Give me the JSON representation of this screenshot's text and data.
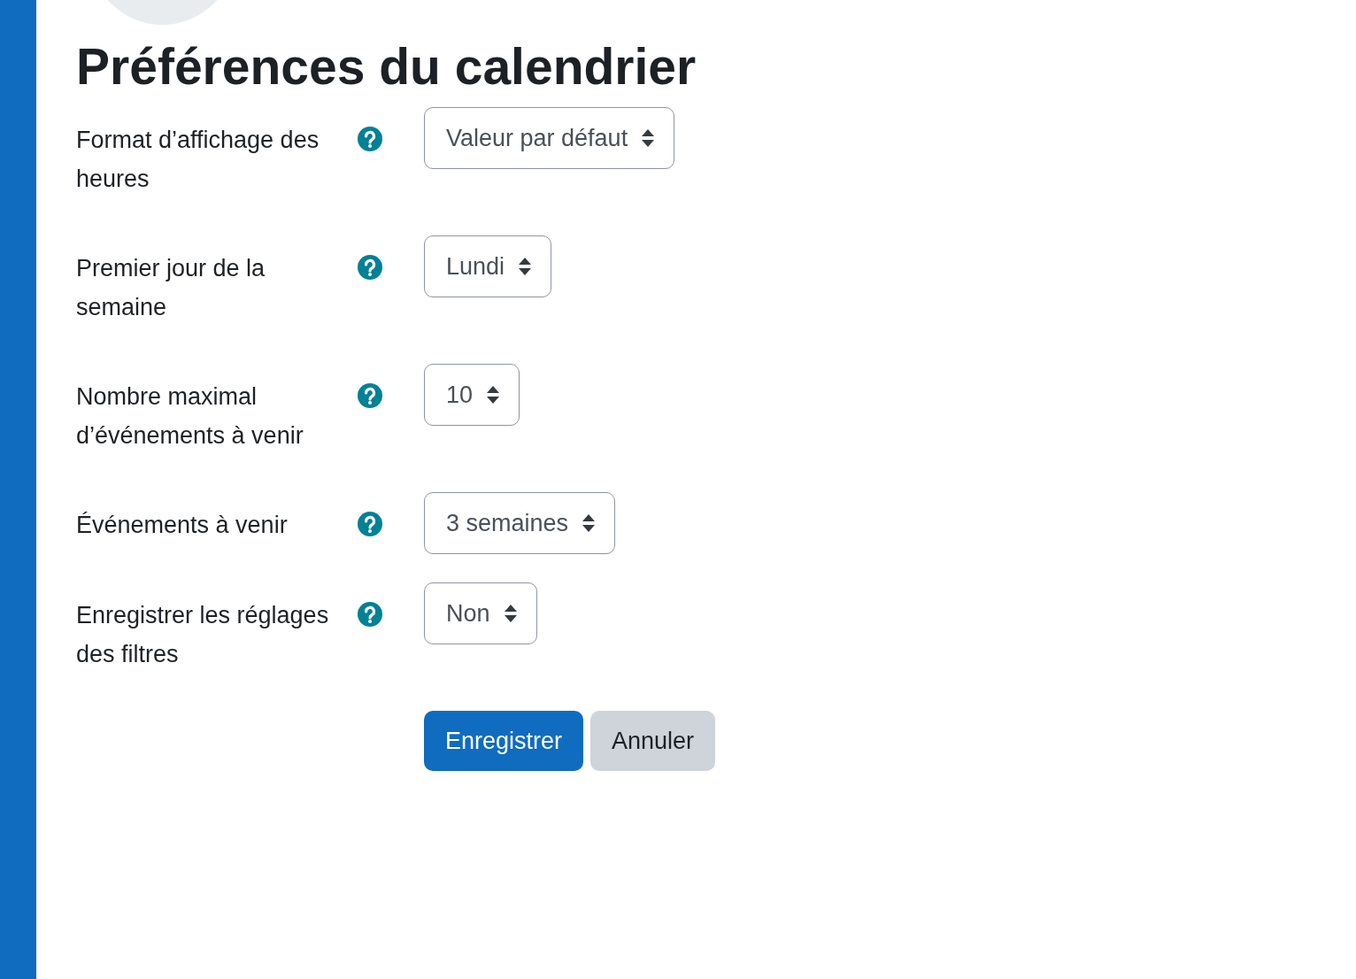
{
  "title": "Préférences du calendrier",
  "fields": [
    {
      "label": "Format d’affichage des heures",
      "value": "Valeur par défaut"
    },
    {
      "label": "Premier jour de la semaine",
      "value": "Lundi"
    },
    {
      "label": "Nombre maximal d’événements à venir",
      "value": "10"
    },
    {
      "label": "Événements à venir",
      "value": "3 semaines"
    },
    {
      "label": "Enregistrer les réglages des filtres",
      "value": "Non"
    }
  ],
  "buttons": [
    {
      "label": "Enregistrer",
      "kind": "primary"
    },
    {
      "label": "Annuler",
      "kind": "secondary"
    }
  ]
}
